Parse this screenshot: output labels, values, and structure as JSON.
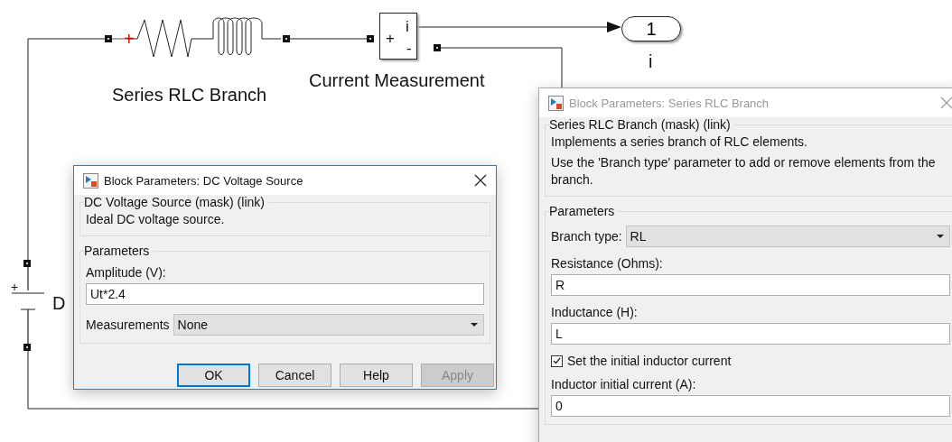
{
  "diagram": {
    "branch": {
      "label": "Series RLC Branch",
      "polarity": "+"
    },
    "measurement": {
      "label": "Current Measurement",
      "plus": "+",
      "output": "i",
      "minus": "-"
    },
    "outport": {
      "number": "1",
      "label": "i"
    },
    "source": {
      "label": "D",
      "polarity": "+"
    }
  },
  "dialogs": [
    {
      "title": "Block Parameters: DC Voltage Source",
      "active": true,
      "mask_title": "DC Voltage Source (mask) (link)",
      "description": [
        "Ideal DC voltage source."
      ],
      "parameters_title": "Parameters",
      "params": [
        {
          "kind": "field",
          "label": "Amplitude (V):",
          "value": "Ut*2.4"
        },
        {
          "kind": "select",
          "label": "Measurements",
          "value": "None"
        }
      ],
      "buttons": [
        {
          "label": "OK",
          "focused": true,
          "disabled": false
        },
        {
          "label": "Cancel",
          "focused": false,
          "disabled": false
        },
        {
          "label": "Help",
          "focused": false,
          "disabled": false
        },
        {
          "label": "Apply",
          "focused": false,
          "disabled": true
        }
      ]
    },
    {
      "title": "Block Parameters: Series RLC Branch",
      "active": false,
      "mask_title": "Series RLC Branch (mask) (link)",
      "description": [
        "Implements a series branch of RLC elements.",
        "Use the 'Branch type' parameter to add or remove elements from the branch."
      ],
      "parameters_title": "Parameters",
      "params": [
        {
          "kind": "select",
          "label": "Branch type:",
          "value": "RL"
        },
        {
          "kind": "field",
          "label": "Resistance (Ohms):",
          "value": "R"
        },
        {
          "kind": "field",
          "label": "Inductance (H):",
          "value": "L"
        },
        {
          "kind": "checkbox",
          "label": "Set the initial inductor current",
          "checked": true
        },
        {
          "kind": "field",
          "label": "Inductor initial current (A):",
          "value": "0"
        }
      ]
    }
  ]
}
